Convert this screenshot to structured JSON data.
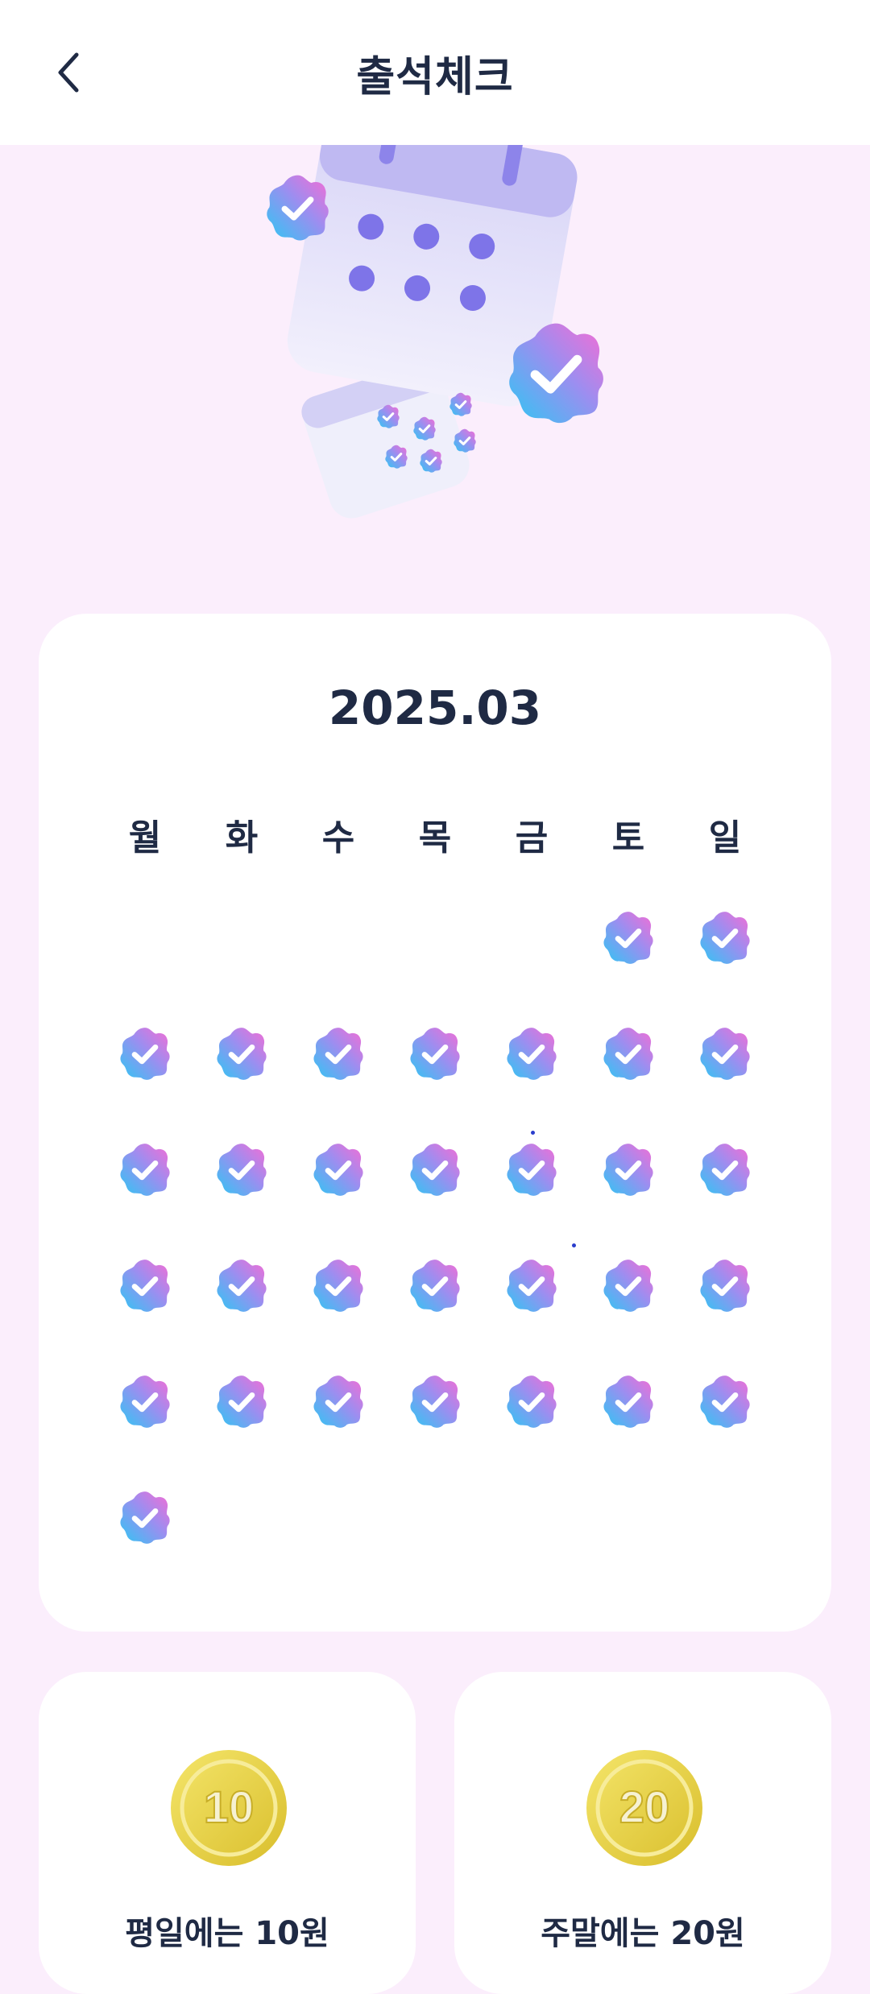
{
  "header": {
    "title": "출석체크",
    "back_icon": "chevron-left-icon"
  },
  "calendar": {
    "month": "2025.03",
    "weekdays": [
      "월",
      "화",
      "수",
      "목",
      "금",
      "토",
      "일"
    ],
    "checked_days": 31,
    "start_weekday_index": 5
  },
  "rewards": [
    {
      "coin_value": "10",
      "label": "평일에는 10원"
    },
    {
      "coin_value": "20",
      "label": "주말에는 20원"
    }
  ],
  "colors": {
    "background": "#FBEEFC",
    "card": "#FFFFFF",
    "text": "#1F2A44",
    "stamp_gradient_start": "#2EC7F3",
    "stamp_gradient_end": "#F76CD4",
    "coin": "#E6CF3C"
  }
}
